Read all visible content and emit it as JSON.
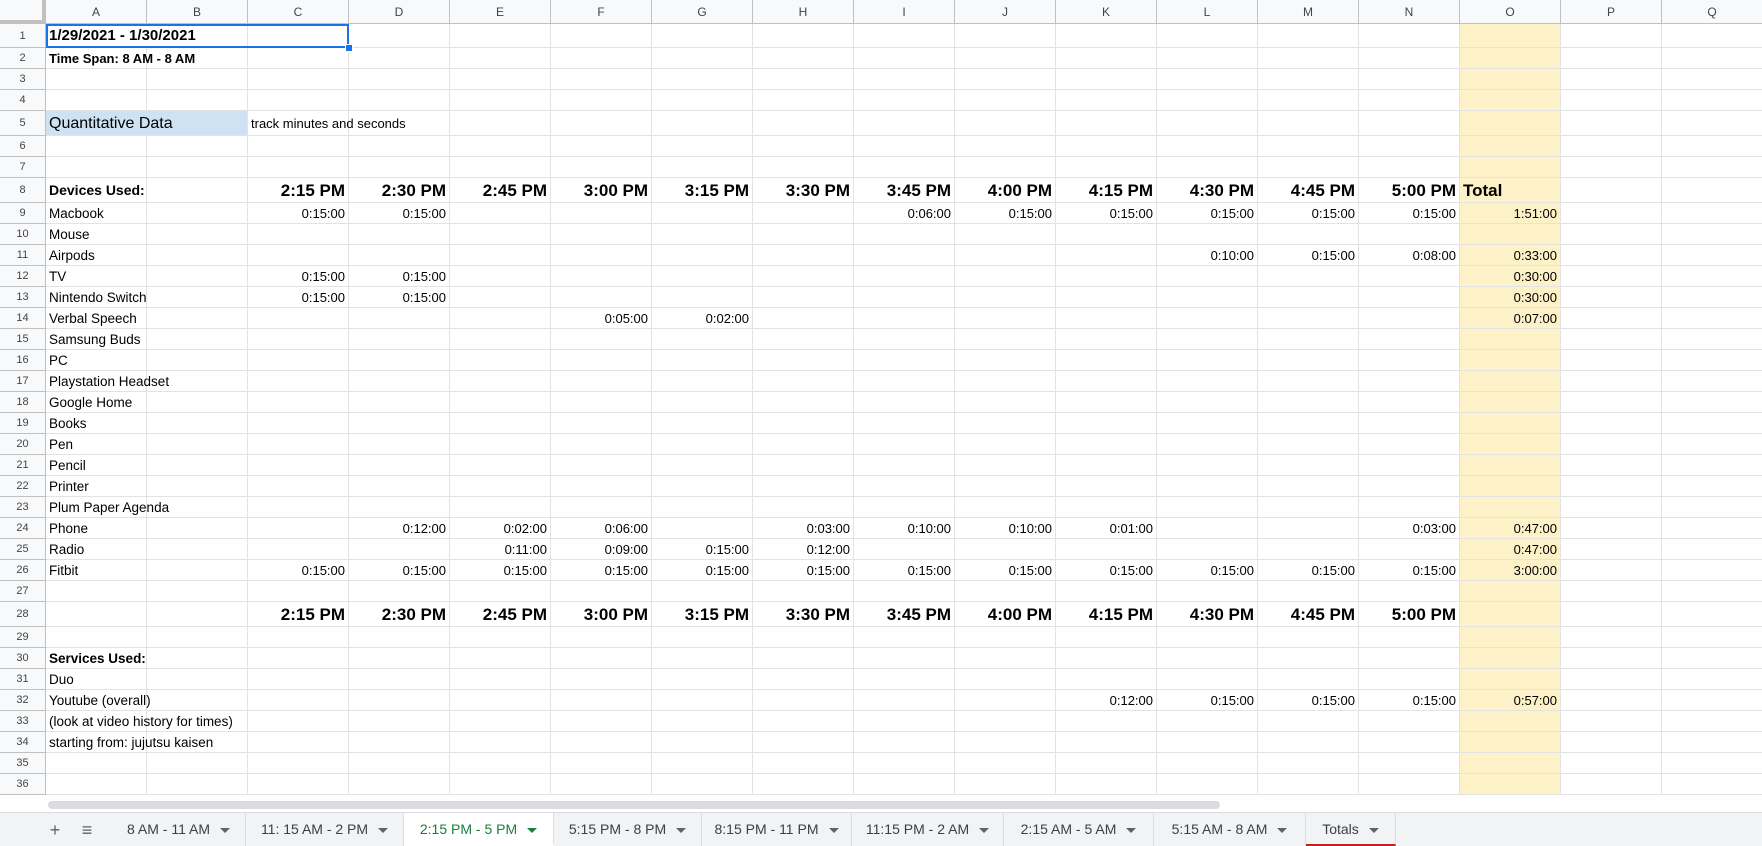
{
  "columns": [
    "A",
    "B",
    "C",
    "D",
    "E",
    "F",
    "G",
    "H",
    "I",
    "J",
    "K",
    "L",
    "M",
    "N",
    "O",
    "P",
    "Q"
  ],
  "rows": [
    "1",
    "2",
    "3",
    "4",
    "5",
    "6",
    "7",
    "8",
    "9",
    "10",
    "11",
    "12",
    "13",
    "14",
    "15",
    "16",
    "17",
    "18",
    "19",
    "20",
    "21",
    "22",
    "23",
    "24",
    "25",
    "26",
    "27",
    "28",
    "29",
    "30",
    "31",
    "32",
    "33",
    "34",
    "35",
    "36"
  ],
  "header": {
    "date_range": "1/29/2021 - 1/30/2021",
    "time_span": "Time Span: 8 AM - 8 AM",
    "quant_label": "Quantitative Data",
    "quant_note": "track minutes and seconds"
  },
  "devices_label": "Devices Used:",
  "times": [
    "2:15 PM",
    "2:30 PM",
    "2:45 PM",
    "3:00 PM",
    "3:15 PM",
    "3:30 PM",
    "3:45 PM",
    "4:00 PM",
    "4:15 PM",
    "4:30 PM",
    "4:45 PM",
    "5:00 PM"
  ],
  "total_label": "Total",
  "devices": [
    {
      "row": 9,
      "name": "Macbook",
      "values": [
        "0:15:00",
        "0:15:00",
        "",
        "",
        "",
        "",
        "0:06:00",
        "0:15:00",
        "0:15:00",
        "0:15:00",
        "0:15:00",
        "0:15:00"
      ],
      "total": "1:51:00"
    },
    {
      "row": 10,
      "name": "Mouse",
      "values": [
        "",
        "",
        "",
        "",
        "",
        "",
        "",
        "",
        "",
        "",
        "",
        ""
      ],
      "total": ""
    },
    {
      "row": 11,
      "name": "Airpods",
      "values": [
        "",
        "",
        "",
        "",
        "",
        "",
        "",
        "",
        "",
        "0:10:00",
        "0:15:00",
        "0:08:00"
      ],
      "total": "0:33:00"
    },
    {
      "row": 12,
      "name": "TV",
      "values": [
        "0:15:00",
        "0:15:00",
        "",
        "",
        "",
        "",
        "",
        "",
        "",
        "",
        "",
        ""
      ],
      "total": "0:30:00"
    },
    {
      "row": 13,
      "name": "Nintendo Switch",
      "values": [
        "0:15:00",
        "0:15:00",
        "",
        "",
        "",
        "",
        "",
        "",
        "",
        "",
        "",
        ""
      ],
      "total": "0:30:00"
    },
    {
      "row": 14,
      "name": "Verbal Speech",
      "values": [
        "",
        "",
        "",
        "0:05:00",
        "0:02:00",
        "",
        "",
        "",
        "",
        "",
        "",
        ""
      ],
      "total": "0:07:00"
    },
    {
      "row": 15,
      "name": "Samsung Buds",
      "values": [
        "",
        "",
        "",
        "",
        "",
        "",
        "",
        "",
        "",
        "",
        "",
        ""
      ],
      "total": ""
    },
    {
      "row": 16,
      "name": "PC",
      "values": [
        "",
        "",
        "",
        "",
        "",
        "",
        "",
        "",
        "",
        "",
        "",
        ""
      ],
      "total": ""
    },
    {
      "row": 17,
      "name": "Playstation Headset",
      "values": [
        "",
        "",
        "",
        "",
        "",
        "",
        "",
        "",
        "",
        "",
        "",
        ""
      ],
      "total": ""
    },
    {
      "row": 18,
      "name": "Google Home",
      "values": [
        "",
        "",
        "",
        "",
        "",
        "",
        "",
        "",
        "",
        "",
        "",
        ""
      ],
      "total": ""
    },
    {
      "row": 19,
      "name": "Books",
      "values": [
        "",
        "",
        "",
        "",
        "",
        "",
        "",
        "",
        "",
        "",
        "",
        ""
      ],
      "total": ""
    },
    {
      "row": 20,
      "name": "Pen",
      "values": [
        "",
        "",
        "",
        "",
        "",
        "",
        "",
        "",
        "",
        "",
        "",
        ""
      ],
      "total": ""
    },
    {
      "row": 21,
      "name": "Pencil",
      "values": [
        "",
        "",
        "",
        "",
        "",
        "",
        "",
        "",
        "",
        "",
        "",
        ""
      ],
      "total": ""
    },
    {
      "row": 22,
      "name": "Printer",
      "values": [
        "",
        "",
        "",
        "",
        "",
        "",
        "",
        "",
        "",
        "",
        "",
        ""
      ],
      "total": ""
    },
    {
      "row": 23,
      "name": "Plum Paper Agenda",
      "values": [
        "",
        "",
        "",
        "",
        "",
        "",
        "",
        "",
        "",
        "",
        "",
        ""
      ],
      "total": ""
    },
    {
      "row": 24,
      "name": "Phone",
      "values": [
        "",
        "0:12:00",
        "0:02:00",
        "0:06:00",
        "",
        "0:03:00",
        "0:10:00",
        "0:10:00",
        "0:01:00",
        "",
        "",
        "0:03:00"
      ],
      "total": "0:47:00"
    },
    {
      "row": 25,
      "name": "Radio",
      "values": [
        "",
        "",
        "0:11:00",
        "0:09:00",
        "0:15:00",
        "0:12:00",
        "",
        "",
        "",
        "",
        "",
        ""
      ],
      "total": "0:47:00"
    },
    {
      "row": 26,
      "name": "Fitbit",
      "values": [
        "0:15:00",
        "0:15:00",
        "0:15:00",
        "0:15:00",
        "0:15:00",
        "0:15:00",
        "0:15:00",
        "0:15:00",
        "0:15:00",
        "0:15:00",
        "0:15:00",
        "0:15:00"
      ],
      "total": "3:00:00"
    }
  ],
  "services_label": "Services Used:",
  "services": [
    {
      "row": 31,
      "name": "Duo",
      "values": [
        "",
        "",
        "",
        "",
        "",
        "",
        "",
        "",
        "",
        "",
        "",
        ""
      ],
      "total": ""
    },
    {
      "row": 32,
      "name": "Youtube (overall)",
      "values": [
        "",
        "",
        "",
        "",
        "",
        "",
        "",
        "",
        "0:12:00",
        "0:15:00",
        "0:15:00",
        "0:15:00"
      ],
      "total": "0:57:00"
    },
    {
      "row": 33,
      "name": "(look at video history for times)",
      "values": [
        "",
        "",
        "",
        "",
        "",
        "",
        "",
        "",
        "",
        "",
        "",
        ""
      ],
      "total": ""
    },
    {
      "row": 34,
      "name": "starting from: jujutsu kaisen",
      "values": [
        "",
        "",
        "",
        "",
        "",
        "",
        "",
        "",
        "",
        "",
        "",
        ""
      ],
      "total": ""
    }
  ],
  "tabs": {
    "add_icon": "plus-icon",
    "list_icon": "list-icon",
    "items": [
      {
        "label": "8 AM - 11 AM",
        "active": false
      },
      {
        "label": "11: 15 AM - 2 PM",
        "active": false
      },
      {
        "label": "2:15 PM - 5 PM",
        "active": true
      },
      {
        "label": "5:15 PM - 8 PM",
        "active": false
      },
      {
        "label": "8:15 PM - 11 PM",
        "active": false
      },
      {
        "label": "11:15 PM - 2 AM",
        "active": false
      },
      {
        "label": "2:15 AM - 5 AM",
        "active": false
      },
      {
        "label": "5:15 AM - 8 AM",
        "active": false
      },
      {
        "label": "Totals",
        "active": false
      }
    ]
  },
  "colors": {
    "total_fill": "#fdf1c8",
    "quant_fill": "#cfe2f3",
    "active_tab": "#188038",
    "selection": "#1a73e8"
  }
}
